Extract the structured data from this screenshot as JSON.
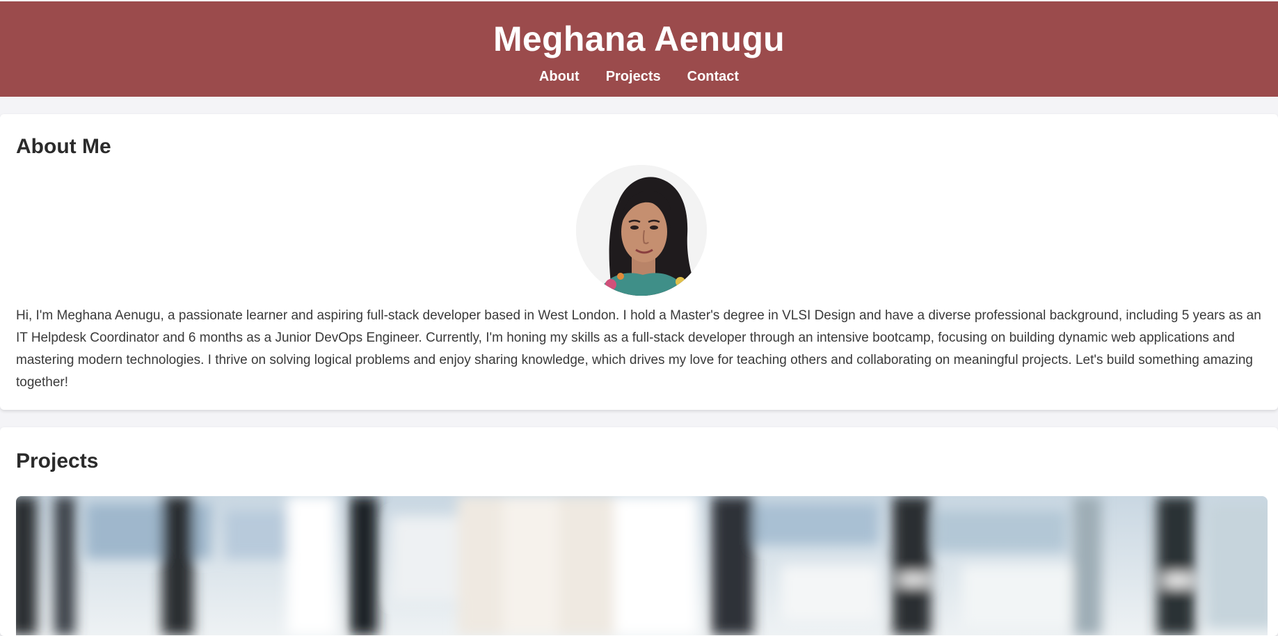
{
  "header": {
    "title": "Meghana Aenugu",
    "nav": [
      {
        "label": "About"
      },
      {
        "label": "Projects"
      },
      {
        "label": "Contact"
      }
    ]
  },
  "about": {
    "heading": "About Me",
    "bio": "Hi, I'm Meghana Aenugu, a passionate learner and aspiring full-stack developer based in West London. I hold a Master's degree in VLSI Design and have a diverse professional background, including 5 years as an IT Helpdesk Coordinator and 6 months as a Junior DevOps Engineer. Currently, I'm honing my skills as a full-stack developer through an intensive bootcamp, focusing on building dynamic web applications and mastering modern technologies. I thrive on solving logical problems and enjoy sharing knowledge, which drives my love for teaching others and collaborating on meaningful projects. Let's build something amazing together!"
  },
  "projects": {
    "heading": "Projects"
  },
  "colors": {
    "header_bg": "#9b4b4c",
    "page_bg": "#f4f4f7",
    "card_bg": "#ffffff",
    "text": "#333333"
  }
}
